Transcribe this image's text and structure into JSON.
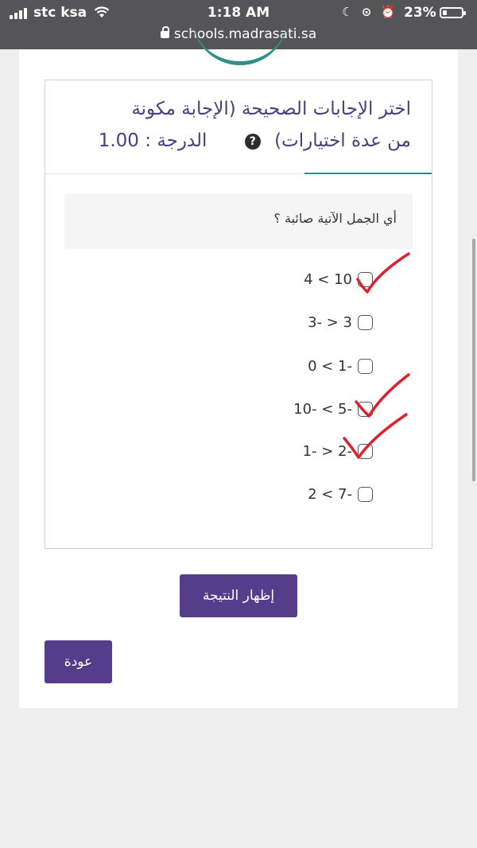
{
  "status_bar": {
    "carrier": "stc ksa",
    "time": "1:18 AM",
    "battery": "23%",
    "battery_level": 0.23
  },
  "url_bar": {
    "url": "schools.madrasati.sa"
  },
  "question": {
    "title_line1": "اختر الإجابات الصحيحة (الإجابة مكونة",
    "title_line2": "من عدة اختيارات)",
    "grade": "الدرجة : 1.00",
    "prompt": "أي الجمل الآتية صائبة ؟",
    "options": [
      {
        "label": "4 < 10",
        "checked": false,
        "annotated_tick": true
      },
      {
        "label": "3- > 3",
        "checked": false,
        "annotated_tick": false
      },
      {
        "label": "0 < 1-",
        "checked": false,
        "annotated_tick": false
      },
      {
        "label": "10- < 5-",
        "checked": false,
        "annotated_tick": true
      },
      {
        "label": "1- > 2-",
        "checked": false,
        "annotated_tick": true
      },
      {
        "label": "2 < 7-",
        "checked": false,
        "annotated_tick": false
      }
    ]
  },
  "buttons": {
    "show_result": "إظهار النتيجة",
    "back": "عودة"
  },
  "colors": {
    "accent": "#563d8c",
    "title_text": "#4a3f7c",
    "teal": "#2e8f85",
    "annotation": "#e0202e"
  }
}
